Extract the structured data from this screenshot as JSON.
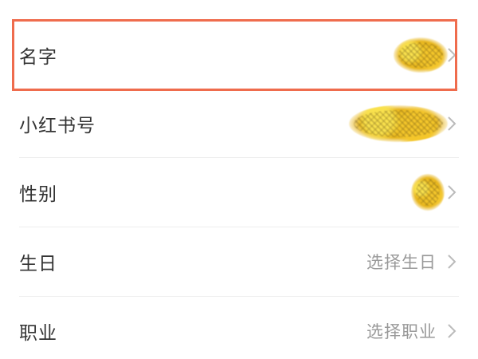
{
  "profile_fields": {
    "items": [
      {
        "label": "名字",
        "value": ""
      },
      {
        "label": "小红书号",
        "value": ""
      },
      {
        "label": "性别",
        "value": ""
      },
      {
        "label": "生日",
        "value": "选择生日"
      },
      {
        "label": "职业",
        "value": "选择职业"
      }
    ]
  },
  "icons": {
    "chevron": "chevron-right-icon",
    "redaction": "redaction-scribble"
  },
  "colors": {
    "highlight_border": "#ef6c4d",
    "label_text": "#333333",
    "value_text": "#999999",
    "divider": "#eeeeee",
    "redaction": "#f2c92b"
  }
}
